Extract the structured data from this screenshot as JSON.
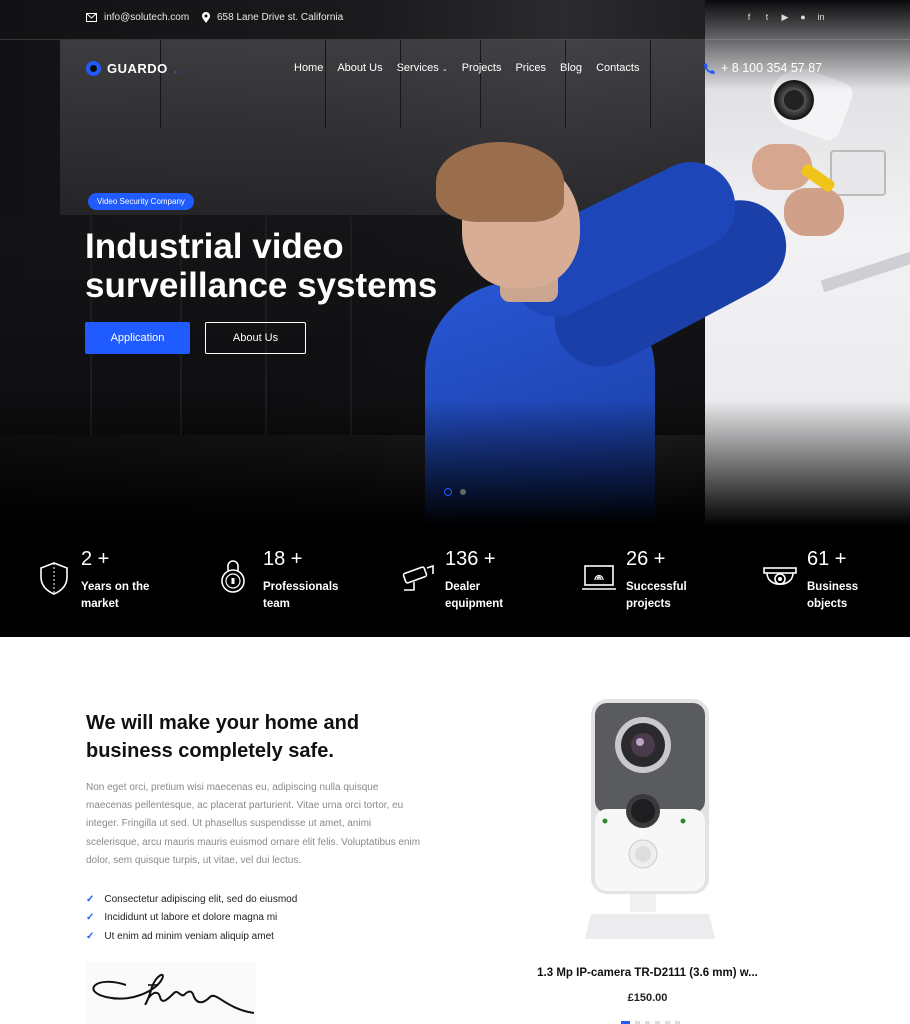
{
  "topbar": {
    "email": "info@solutech.com",
    "address": "658 Lane Drive st. California",
    "socials": [
      "facebook-icon",
      "twitter-icon",
      "youtube-icon",
      "github-icon",
      "linkedin-icon"
    ]
  },
  "nav": {
    "logo": "GUARDO",
    "menu": [
      "Home",
      "About Us",
      "Services",
      "Projects",
      "Prices",
      "Blog",
      "Contacts"
    ],
    "phone": "+ 8 100 354 57 87"
  },
  "hero": {
    "badge": "Video Security Company",
    "title": "Industrial video surveillance systems",
    "primary_button": "Application",
    "secondary_button": "About Us",
    "slides_total": 2,
    "active_slide": 1
  },
  "stats": [
    {
      "number": "2 +",
      "label": "Years on the market",
      "icon": "shield-icon"
    },
    {
      "number": "18 +",
      "label": "Professionals team",
      "icon": "lock-icon"
    },
    {
      "number": "136 +",
      "label": "Dealer equipment",
      "icon": "cctv-camera-icon"
    },
    {
      "number": "26 +",
      "label": "Successful projects",
      "icon": "laptop-fingerprint-icon"
    },
    {
      "number": "61 +",
      "label": "Business objects",
      "icon": "dome-camera-icon"
    }
  ],
  "about": {
    "title": "We will make your home and business completely safe.",
    "text": "Non eget orci, pretium wisi maecenas eu, adipiscing nulla quisque maecenas pellentesque, ac placerat parturient. Vitae urna orci tortor, eu integer. Fringilla ut sed. Ut phasellus suspendisse ut amet, animi scelerisque, arcu mauris mauris euismod ornare elit felis. Voluptatibus enim dolor, sem quisque turpis, ut vitae, vel dui lectus.",
    "checks": [
      "Consectetur adipiscing elit, sed do eiusmod",
      "Incididunt ut labore et dolore magna mi",
      "Ut enim ad minim veniam aliquip amet"
    ]
  },
  "product": {
    "name": "1.3 Mp IP-camera TR-D2111 (3.6 mm) w...",
    "price": "£150.00"
  },
  "colors": {
    "accent": "#1f5bff",
    "dark": "#000000"
  }
}
